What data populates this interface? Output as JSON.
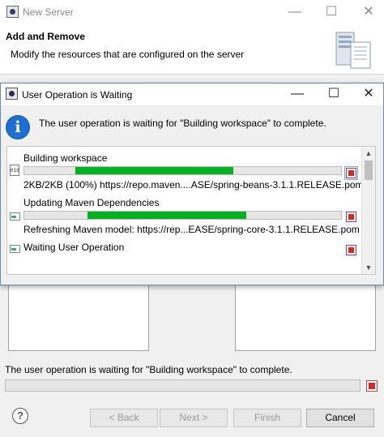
{
  "background_window": {
    "title": "New Server",
    "header_title": "Add and Remove",
    "header_description": "Modify the resources that are configured on the server",
    "status_message": "The user operation is waiting for \"Building workspace\" to complete.",
    "buttons": {
      "help": "?",
      "back": "< Back",
      "next": "Next >",
      "finish": "Finish",
      "cancel": "Cancel"
    },
    "window_controls": {
      "minimize": "—",
      "maximize": "☐",
      "close": "✕"
    }
  },
  "dialog": {
    "title": "User Operation is Waiting",
    "message": "The user operation is waiting for \"Building workspace\" to complete.",
    "info_icon_glyph": "i",
    "window_controls": {
      "minimize": "—",
      "maximize": "☐",
      "close": "✕"
    },
    "jobs": [
      {
        "name": "Building workspace",
        "detail": "2KB/2KB (100%) https://repo.maven....ASE/spring-beans-3.1.1.RELEASE.pom",
        "icon": "java-file-icon",
        "progress": 0.5
      },
      {
        "name": "Updating Maven Dependencies",
        "detail": "Refreshing Maven model: https://rep...EASE/spring-core-3.1.1.RELEASE.pom",
        "icon": "job-progress-icon",
        "progress": 0.5
      },
      {
        "name": "Waiting User Operation",
        "detail": "",
        "icon": "job-progress-icon",
        "progress": null
      }
    ],
    "scroll_arrows": {
      "up": "▲",
      "down": "▼"
    }
  },
  "colors": {
    "progress_green": "#06b025",
    "stop_red": "#d02a2a",
    "info_blue": "#1f6fd0"
  }
}
